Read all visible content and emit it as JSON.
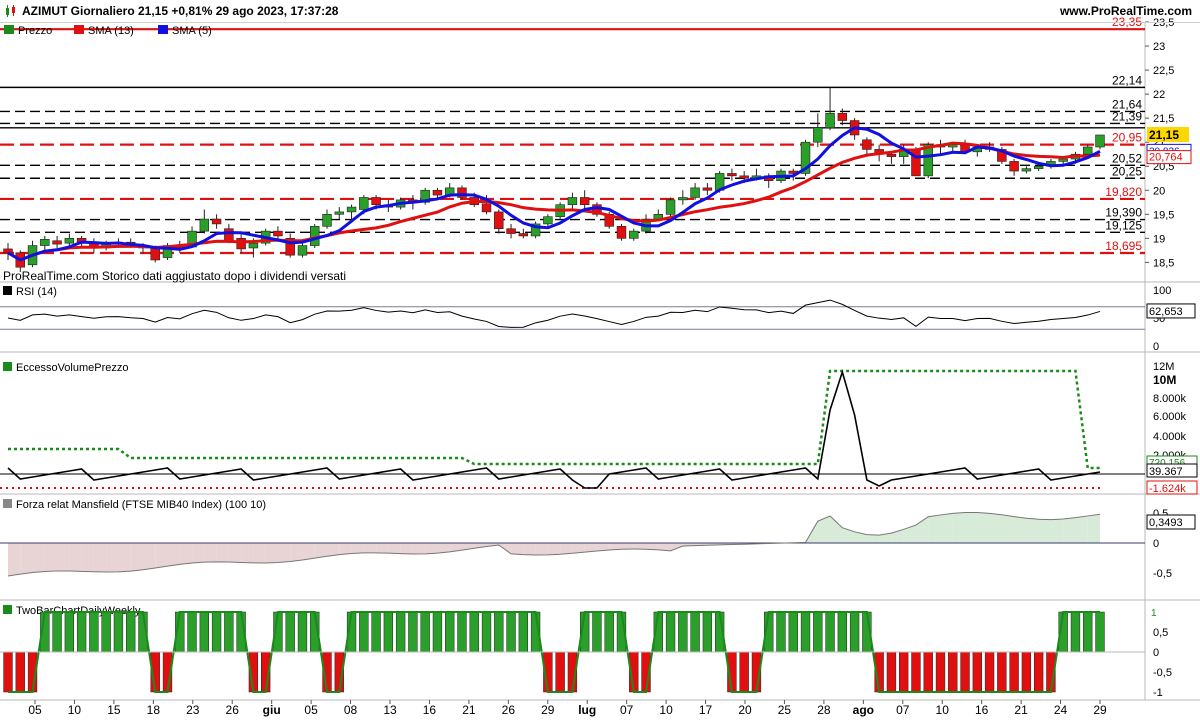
{
  "header": {
    "title": "AZIMUT Giornaliero 21,15 +0,81% 29 ago 2023, 17:37:28",
    "site": "www.ProRealTime.com"
  },
  "panels": {
    "price": {
      "legend": [
        {
          "label": "Prezzo",
          "color": "#1a8a1a"
        },
        {
          "label": "SMA (13)",
          "color": "#e01010"
        },
        {
          "label": "SMA (5)",
          "color": "#1010e0"
        }
      ],
      "footnote": "ProRealTime.com  Storico dati aggiustato dopo i dividendi versati"
    },
    "rsi": {
      "label": "RSI (14)",
      "value": "62,653",
      "axis": [
        "100",
        "50",
        "0"
      ]
    },
    "volume": {
      "label": "EccessoVolumePrezzo",
      "values": [
        "720.156",
        "39.367",
        "-1.624k"
      ],
      "axis": [
        "12M",
        "10M",
        "8.000k",
        "6.000k",
        "4.000k",
        "2.000k"
      ]
    },
    "mansfield": {
      "label": "Forza relat Mansfield (FTSE MIB40 Index) (100 10)",
      "value": "0,3493",
      "axis": [
        "0,5",
        "0",
        "-0,5"
      ]
    },
    "twobar": {
      "label": "TwoBarChartDailyWeekly",
      "value": "1",
      "axis": [
        "0,5",
        "0",
        "-0,5",
        "-1"
      ]
    }
  },
  "x_axis_labels": [
    "05",
    "10",
    "15",
    "18",
    "23",
    "26",
    "giu",
    "05",
    "08",
    "13",
    "16",
    "21",
    "26",
    "29",
    "lug",
    "07",
    "10",
    "17",
    "20",
    "25",
    "28",
    "ago",
    "07",
    "10",
    "16",
    "21",
    "24",
    "29"
  ],
  "chart_data": {
    "type": "candlestick",
    "y_axis_ticks": [
      "23,5",
      "23",
      "22,5",
      "22",
      "21,5",
      "21",
      "20,5",
      "20",
      "19,5",
      "19",
      "18,5"
    ],
    "ylim": [
      18.3,
      23.5
    ],
    "last_price": "21,15",
    "sma_values": [
      "20,836",
      "20,764"
    ],
    "level_lines": [
      {
        "value": 23.35,
        "label": "23,35",
        "color": "#e01010",
        "style": "solid"
      },
      {
        "value": 22.14,
        "label": "22,14",
        "color": "#000000",
        "style": "solid"
      },
      {
        "value": 21.64,
        "label": "21,64",
        "color": "#000000",
        "style": "dashed"
      },
      {
        "value": 21.39,
        "label": "21,39",
        "color": "#000000",
        "style": "dashed"
      },
      {
        "value": 21.3,
        "label": "21,30",
        "color": "#000000",
        "style": "solid"
      },
      {
        "value": 20.95,
        "label": "20,95",
        "color": "#e01010",
        "style": "dashed"
      },
      {
        "value": 20.52,
        "label": "20,52",
        "color": "#000000",
        "style": "dashed"
      },
      {
        "value": 20.25,
        "label": "20,25",
        "color": "#000000",
        "style": "dashed"
      },
      {
        "value": 19.82,
        "label": "19,820",
        "color": "#e01010",
        "style": "dashed"
      },
      {
        "value": 19.39,
        "label": "19,390",
        "color": "#000000",
        "style": "dashed"
      },
      {
        "value": 19.125,
        "label": "19,125",
        "color": "#000000",
        "style": "dashed"
      },
      {
        "value": 18.695,
        "label": "18,695",
        "color": "#e01010",
        "style": "dashed"
      }
    ],
    "candles": [
      [
        18.78,
        18.9,
        18.55,
        18.7
      ],
      [
        18.7,
        18.75,
        18.3,
        18.4
      ],
      [
        18.45,
        18.95,
        18.4,
        18.85
      ],
      [
        18.85,
        19.05,
        18.75,
        18.98
      ],
      [
        18.95,
        19.05,
        18.8,
        18.88
      ],
      [
        18.9,
        19.1,
        18.8,
        19.0
      ],
      [
        19.0,
        19.05,
        18.8,
        18.9
      ],
      [
        18.9,
        19.0,
        18.7,
        18.8
      ],
      [
        18.8,
        18.95,
        18.75,
        18.9
      ],
      [
        18.9,
        19.0,
        18.8,
        18.92
      ],
      [
        18.92,
        19.0,
        18.8,
        18.85
      ],
      [
        18.85,
        18.9,
        18.7,
        18.8
      ],
      [
        18.8,
        18.85,
        18.5,
        18.55
      ],
      [
        18.6,
        18.9,
        18.55,
        18.85
      ],
      [
        18.85,
        18.95,
        18.7,
        18.8
      ],
      [
        18.82,
        19.25,
        18.8,
        19.15
      ],
      [
        19.15,
        19.6,
        19.1,
        19.4
      ],
      [
        19.4,
        19.5,
        19.2,
        19.3
      ],
      [
        19.2,
        19.3,
        18.9,
        18.95
      ],
      [
        19.0,
        19.1,
        18.7,
        18.78
      ],
      [
        18.8,
        19.0,
        18.6,
        18.9
      ],
      [
        18.9,
        19.2,
        18.85,
        19.15
      ],
      [
        19.15,
        19.25,
        18.95,
        19.05
      ],
      [
        19.0,
        19.1,
        18.6,
        18.65
      ],
      [
        18.65,
        18.9,
        18.6,
        18.85
      ],
      [
        18.85,
        19.3,
        18.8,
        19.25
      ],
      [
        19.25,
        19.6,
        19.2,
        19.5
      ],
      [
        19.5,
        19.65,
        19.4,
        19.55
      ],
      [
        19.55,
        19.7,
        19.4,
        19.65
      ],
      [
        19.6,
        19.9,
        19.5,
        19.85
      ],
      [
        19.85,
        19.9,
        19.6,
        19.7
      ],
      [
        19.7,
        19.8,
        19.55,
        19.65
      ],
      [
        19.65,
        19.85,
        19.6,
        19.8
      ],
      [
        19.8,
        19.9,
        19.6,
        19.75
      ],
      [
        19.75,
        20.05,
        19.7,
        20.0
      ],
      [
        20.0,
        20.05,
        19.8,
        19.9
      ],
      [
        19.9,
        20.15,
        19.85,
        20.05
      ],
      [
        20.05,
        20.1,
        19.8,
        19.85
      ],
      [
        19.85,
        19.95,
        19.65,
        19.7
      ],
      [
        19.72,
        19.9,
        19.5,
        19.55
      ],
      [
        19.55,
        19.6,
        19.1,
        19.2
      ],
      [
        19.2,
        19.3,
        19.0,
        19.1
      ],
      [
        19.1,
        19.2,
        19.0,
        19.05
      ],
      [
        19.05,
        19.35,
        19.0,
        19.3
      ],
      [
        19.3,
        19.5,
        19.2,
        19.45
      ],
      [
        19.45,
        19.75,
        19.4,
        19.7
      ],
      [
        19.7,
        19.95,
        19.6,
        19.85
      ],
      [
        19.85,
        20.0,
        19.6,
        19.7
      ],
      [
        19.7,
        19.75,
        19.45,
        19.5
      ],
      [
        19.5,
        19.55,
        19.2,
        19.25
      ],
      [
        19.25,
        19.3,
        18.95,
        19.0
      ],
      [
        19.0,
        19.2,
        18.95,
        19.15
      ],
      [
        19.15,
        19.5,
        19.1,
        19.4
      ],
      [
        19.4,
        19.6,
        19.35,
        19.5
      ],
      [
        19.5,
        19.85,
        19.45,
        19.8
      ],
      [
        19.8,
        20.0,
        19.7,
        19.85
      ],
      [
        19.85,
        20.15,
        19.8,
        20.05
      ],
      [
        20.05,
        20.15,
        19.9,
        20.0
      ],
      [
        20.0,
        20.4,
        19.95,
        20.35
      ],
      [
        20.35,
        20.45,
        20.2,
        20.3
      ],
      [
        20.3,
        20.4,
        20.15,
        20.25
      ],
      [
        20.25,
        20.45,
        20.2,
        20.3
      ],
      [
        20.3,
        20.35,
        20.05,
        20.2
      ],
      [
        20.2,
        20.45,
        20.15,
        20.4
      ],
      [
        20.4,
        20.45,
        20.2,
        20.35
      ],
      [
        20.35,
        21.05,
        20.3,
        21.0
      ],
      [
        21.0,
        21.6,
        20.9,
        21.3
      ],
      [
        21.3,
        22.14,
        21.25,
        21.6
      ],
      [
        21.6,
        21.7,
        21.35,
        21.45
      ],
      [
        21.45,
        21.5,
        21.05,
        21.15
      ],
      [
        21.05,
        21.1,
        20.7,
        20.85
      ],
      [
        20.85,
        20.95,
        20.6,
        20.75
      ],
      [
        20.75,
        20.8,
        20.55,
        20.7
      ],
      [
        20.7,
        20.95,
        20.55,
        20.85
      ],
      [
        20.85,
        20.9,
        20.3,
        20.3
      ],
      [
        20.3,
        21.0,
        20.25,
        20.95
      ],
      [
        20.95,
        21.05,
        20.75,
        20.9
      ],
      [
        20.9,
        21.0,
        20.8,
        20.95
      ],
      [
        20.95,
        21.05,
        20.75,
        20.8
      ],
      [
        20.8,
        20.95,
        20.7,
        20.9
      ],
      [
        20.9,
        21.0,
        20.8,
        20.85
      ],
      [
        20.85,
        20.9,
        20.55,
        20.6
      ],
      [
        20.6,
        20.65,
        20.3,
        20.4
      ],
      [
        20.4,
        20.5,
        20.35,
        20.45
      ],
      [
        20.45,
        20.55,
        20.4,
        20.5
      ],
      [
        20.5,
        20.65,
        20.45,
        20.6
      ],
      [
        20.6,
        20.7,
        20.5,
        20.65
      ],
      [
        20.65,
        20.8,
        20.55,
        20.75
      ],
      [
        20.75,
        20.95,
        20.7,
        20.9
      ],
      [
        20.9,
        21.15,
        20.85,
        21.15
      ]
    ]
  },
  "colors": {
    "up": "#2aa02a",
    "down": "#e01010",
    "sma13": "#e01010",
    "sma5": "#1010e0",
    "grid": "#7a7a9a"
  }
}
